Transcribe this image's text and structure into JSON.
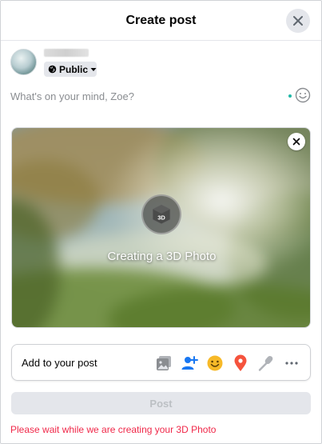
{
  "dialog": {
    "title": "Create post"
  },
  "user": {
    "privacy_label": "Public"
  },
  "composer": {
    "placeholder": "What's on your mind, Zoe?"
  },
  "media": {
    "badge_text": "3D",
    "status_text": "Creating a 3D Photo"
  },
  "add_to_post": {
    "label": "Add to your post",
    "icons": [
      "photo-video-icon",
      "tag-people-icon",
      "feeling-icon",
      "check-in-icon",
      "host-qa-icon",
      "more-icon"
    ]
  },
  "post_button": {
    "label": "Post",
    "disabled": true
  },
  "status": {
    "message": "Please wait while we are creating your 3D Photo"
  },
  "colors": {
    "accent_blue": "#1877f2",
    "feeling_yellow": "#f7b928",
    "checkin_red": "#f5533d",
    "photo_gray": "#8a8d91",
    "error_red": "#f02849",
    "disabled_bg": "#e4e6eb"
  }
}
